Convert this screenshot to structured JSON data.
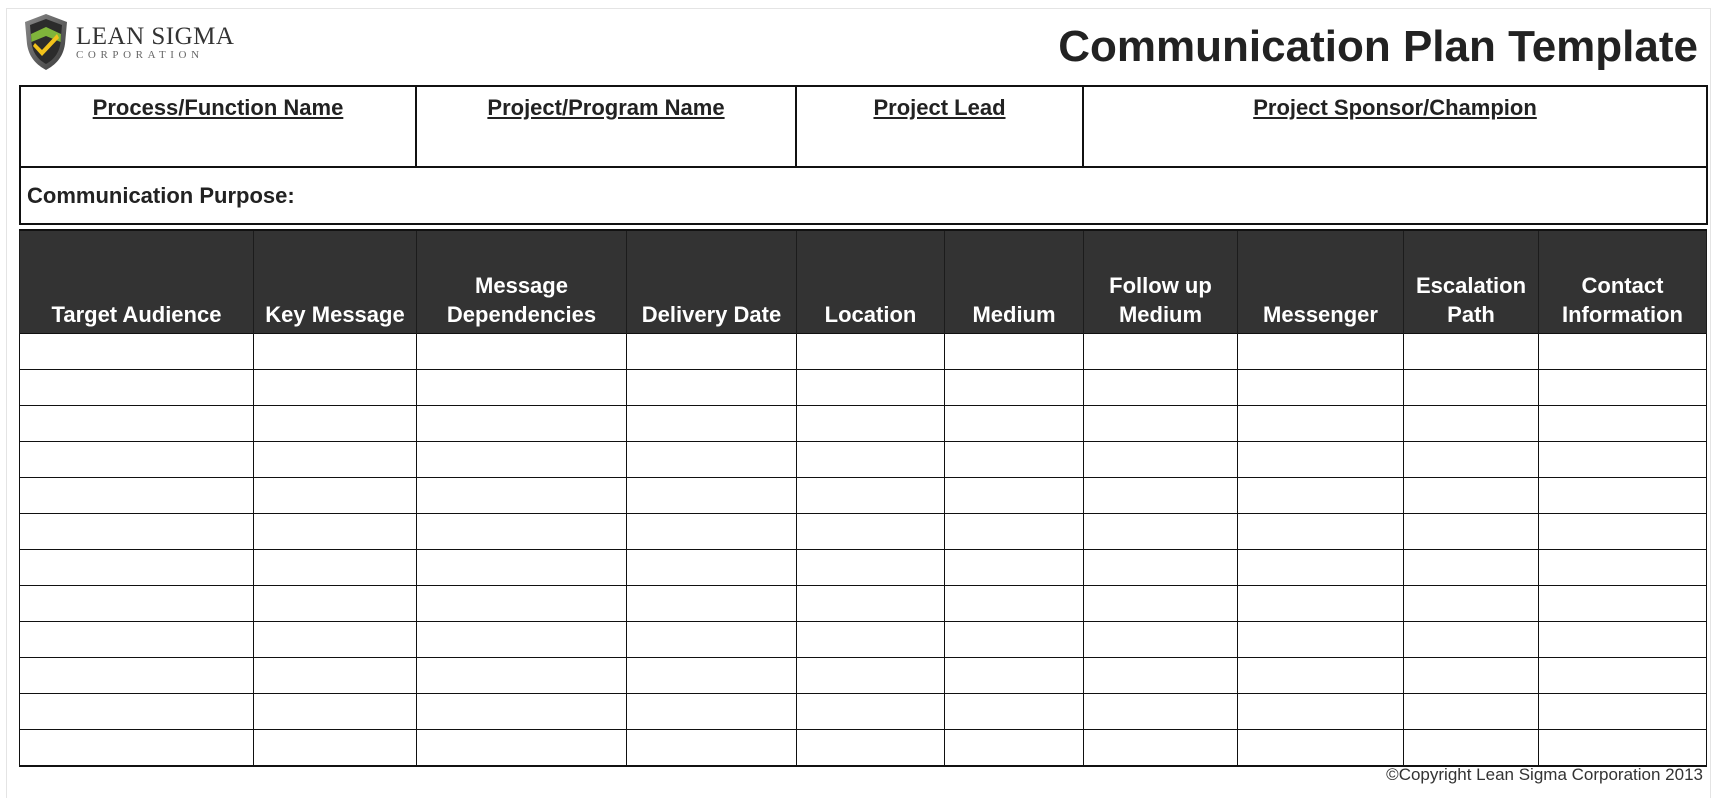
{
  "header": {
    "logo_name": "LEAN SIGMA",
    "logo_subtitle": "CORPORATION",
    "title": "Communication Plan Template"
  },
  "info": {
    "process_function_name": "Process/Function Name",
    "project_program_name": "Project/Program Name",
    "project_lead": "Project Lead",
    "project_sponsor": "Project Sponsor/Champion",
    "purpose_label": "Communication Purpose:"
  },
  "plan_table": {
    "columns": [
      "Target Audience",
      "Key Message",
      "Message Dependencies",
      "Delivery Date",
      "Location",
      "Medium",
      "Follow up Medium",
      "Messenger",
      "Escalation Path",
      "Contact Information"
    ],
    "rows": [
      [
        "",
        "",
        "",
        "",
        "",
        "",
        "",
        "",
        "",
        ""
      ],
      [
        "",
        "",
        "",
        "",
        "",
        "",
        "",
        "",
        "",
        ""
      ],
      [
        "",
        "",
        "",
        "",
        "",
        "",
        "",
        "",
        "",
        ""
      ],
      [
        "",
        "",
        "",
        "",
        "",
        "",
        "",
        "",
        "",
        ""
      ],
      [
        "",
        "",
        "",
        "",
        "",
        "",
        "",
        "",
        "",
        ""
      ],
      [
        "",
        "",
        "",
        "",
        "",
        "",
        "",
        "",
        "",
        ""
      ],
      [
        "",
        "",
        "",
        "",
        "",
        "",
        "",
        "",
        "",
        ""
      ],
      [
        "",
        "",
        "",
        "",
        "",
        "",
        "",
        "",
        "",
        ""
      ],
      [
        "",
        "",
        "",
        "",
        "",
        "",
        "",
        "",
        "",
        ""
      ],
      [
        "",
        "",
        "",
        "",
        "",
        "",
        "",
        "",
        "",
        ""
      ],
      [
        "",
        "",
        "",
        "",
        "",
        "",
        "",
        "",
        "",
        ""
      ],
      [
        "",
        "",
        "",
        "",
        "",
        "",
        "",
        "",
        "",
        ""
      ]
    ]
  },
  "footer": {
    "copyright": "©Copyright Lean Sigma Corporation 2013"
  },
  "colors": {
    "header_fill": "#333333",
    "header_text": "#ffffff",
    "border": "#111111",
    "logo_shield_dark": "#2b2b2b",
    "logo_shield_green": "#7fb53b",
    "logo_check_yellow": "#f2c21b"
  },
  "icons": {
    "logo": "shield-check-icon"
  }
}
